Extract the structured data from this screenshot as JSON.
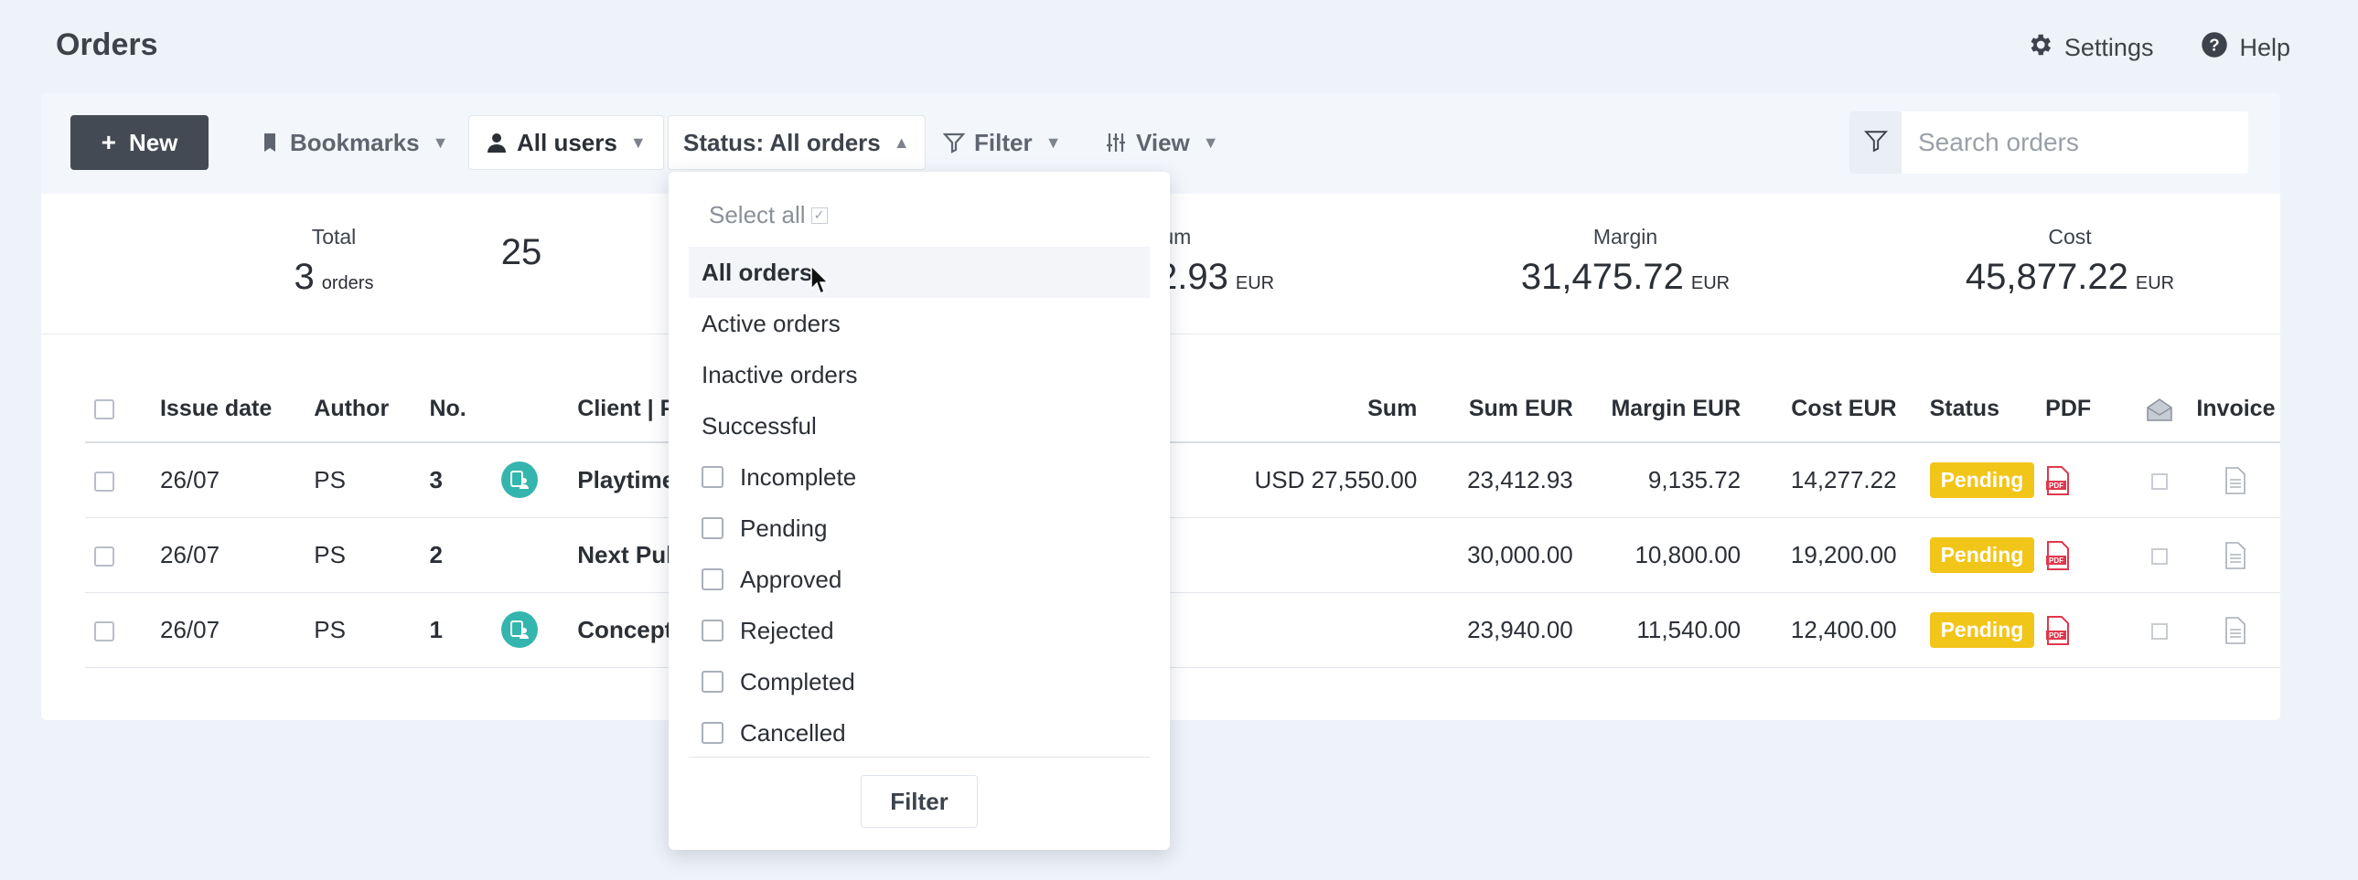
{
  "header": {
    "title": "Orders",
    "settings_label": "Settings",
    "help_label": "Help"
  },
  "toolbar": {
    "new_label": "New",
    "bookmarks_label": "Bookmarks",
    "users_label": "All users",
    "status_label": "Status: All orders",
    "filter_label": "Filter",
    "view_label": "View",
    "search_placeholder": "Search orders"
  },
  "stats": [
    {
      "label": "Total",
      "value": "3",
      "unit": "orders"
    },
    {
      "label": "",
      "value": "25",
      "unit": ""
    },
    {
      "label": "Sum",
      "value": "2.93",
      "unit": "EUR"
    },
    {
      "label": "Margin",
      "value": "31,475.72",
      "unit": "EUR"
    },
    {
      "label": "Cost",
      "value": "45,877.22",
      "unit": "EUR"
    }
  ],
  "table": {
    "headers": {
      "issue_date": "Issue date",
      "author": "Author",
      "no": "No.",
      "client": "Client | Proj",
      "sum": "Sum",
      "sum_eur": "Sum EUR",
      "margin_eur": "Margin EUR",
      "cost_eur": "Cost EUR",
      "status": "Status",
      "pdf": "PDF",
      "invoice": "Invoice"
    },
    "rows": [
      {
        "date": "26/07",
        "author": "PS",
        "no": "3",
        "client": "Playtime LL",
        "sum": "USD 27,550.00",
        "sum_eur": "23,412.93",
        "margin_eur": "9,135.72",
        "cost_eur": "14,277.22",
        "status": "Pending"
      },
      {
        "date": "26/07",
        "author": "PS",
        "no": "2",
        "client": "Next Publish",
        "sum": "",
        "sum_eur": "30,000.00",
        "margin_eur": "10,800.00",
        "cost_eur": "19,200.00",
        "status": "Pending"
      },
      {
        "date": "26/07",
        "author": "PS",
        "no": "1",
        "client": "Concept LL",
        "sum": "",
        "sum_eur": "23,940.00",
        "margin_eur": "11,540.00",
        "cost_eur": "12,400.00",
        "status": "Pending"
      }
    ]
  },
  "dropdown": {
    "select_all": "Select all",
    "options": [
      "All orders",
      "Active orders",
      "Inactive orders",
      "Successful"
    ],
    "checkbox_options": [
      "Incomplete",
      "Pending",
      "Approved",
      "Rejected",
      "Completed",
      "Cancelled"
    ],
    "filter_button": "Filter"
  },
  "colors": {
    "badge_pending": "#f2c519",
    "new_button": "#444a53",
    "client_icon": "#34b5ae",
    "pdf_icon": "#e0384d"
  }
}
